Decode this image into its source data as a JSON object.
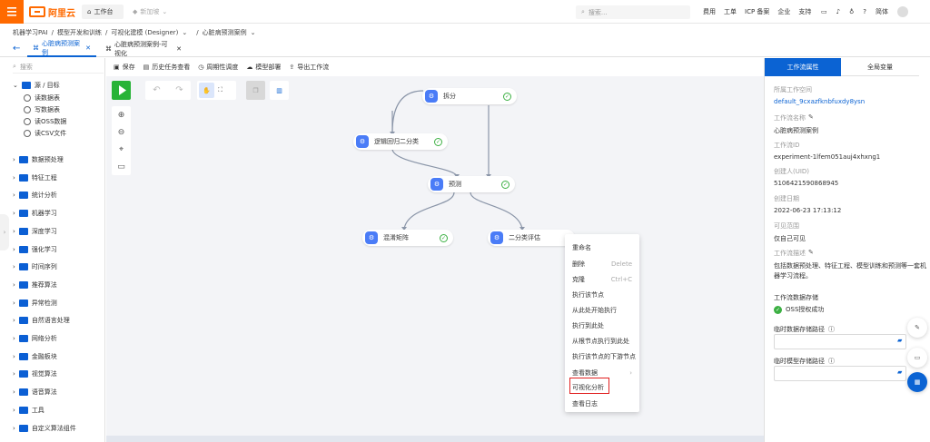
{
  "topbar": {
    "logo_text": "阿里云",
    "workbench_label": "工作台",
    "new_label": "新加坡",
    "search_placeholder": "搜索...",
    "nav": [
      "费用",
      "工单",
      "ICP 备案",
      "企业",
      "支持"
    ],
    "lang": "简体"
  },
  "breadcrumb": [
    "机器学习PAI",
    "/",
    "模型开发和训练",
    "/",
    "可视化建模 (Designer)",
    "/",
    "心脏病预测案例"
  ],
  "tabs": [
    "心脏病预测案例",
    "心脏病预测案例-可视化"
  ],
  "left_panel": {
    "search_placeholder": "搜索",
    "root": "源 / 目标",
    "root_children": [
      "读数据表",
      "写数据表",
      "读OSS数据",
      "读CSV文件"
    ],
    "folders": [
      "数据预处理",
      "特征工程",
      "统计分析",
      "机器学习",
      "深度学习",
      "强化学习",
      "时间序列",
      "推荐算法",
      "异常检测",
      "自然语言处理",
      "网络分析",
      "金融板块",
      "视觉算法",
      "语音算法",
      "工具",
      "自定义算法组件"
    ]
  },
  "toolbar": [
    "保存",
    "历史任务查看",
    "周期性调度",
    "模型部署",
    "导出工作流"
  ],
  "nodes": {
    "split": "拆分",
    "logreg": "逻辑回归二分类",
    "predict": "预测",
    "confusion": "混淆矩阵",
    "binary_eval": "二分类评估"
  },
  "context_menu": {
    "items": [
      "重命名",
      "删除",
      "克隆",
      "执行该节点",
      "从此处开始执行",
      "执行到此处",
      "从根节点执行到此处",
      "执行该节点的下游节点",
      "查看数据",
      "可视化分析",
      "查看日志"
    ],
    "shortcuts": {
      "删除": "Delete",
      "克隆": "Ctrl+C"
    },
    "highlight_color": "#e02020"
  },
  "right_panel": {
    "tab_active": "工作流属性",
    "tab_other": "全局变量",
    "workspace_label": "所属工作空间",
    "workspace_value": "default_9cxazfknbfuxdy8ysn",
    "name_label": "工作流名称",
    "name_value": "心脏病预测案例",
    "id_label": "工作流ID",
    "id_value": "experiment-1lfem051auj4xhxng1",
    "creator_label": "创建人(UID)",
    "creator_value": "5106421590868945",
    "date_label": "创建日期",
    "date_value": "2022-06-23 17:13:12",
    "visibility_label": "可见范围",
    "visibility_value": "仅自己可见",
    "desc_label": "工作流描述",
    "desc_value": "包括数据预处理、特征工程、模型训练和预测等一套机器学习流程。",
    "storage_title": "工作流数据存储",
    "oss_status": "OSS授权成功",
    "tmp_data_label": "临时数据存储路径",
    "tmp_model_label": "临时模型存储路径"
  },
  "colors": {
    "brand": "#ff6a00",
    "primary": "#0b63d3",
    "success": "#3cb043"
  }
}
